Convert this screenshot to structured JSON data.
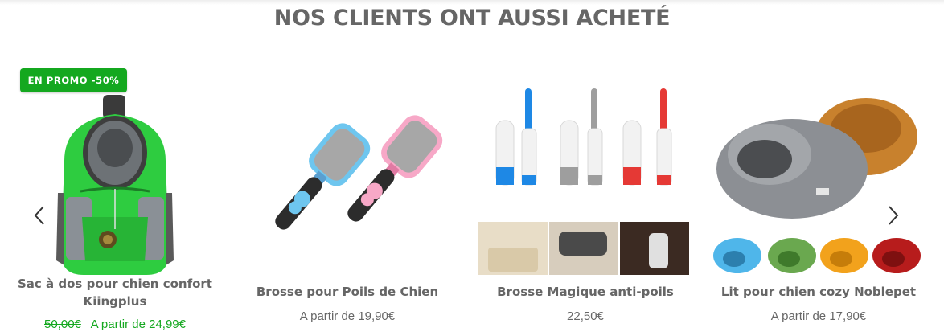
{
  "section": {
    "heading": "NOS CLIENTS ONT AUSSI ACHETÉ"
  },
  "carousel": {
    "prev_icon": "chevron-left-icon",
    "next_icon": "chevron-right-icon",
    "products": [
      {
        "title_line1": "Sac à dos pour chien confort",
        "title_line2": "Kiingplus",
        "badge": "EN PROMO -50%",
        "old_price": "50,00€",
        "price": "A partir de 24,99€"
      },
      {
        "title": "Brosse pour Poils de Chien",
        "price": "A partir de 19,90€"
      },
      {
        "title": "Brosse Magique anti-poils",
        "price": "22,50€"
      },
      {
        "title": "Lit pour chien cozy Noblepet",
        "price": "A partir de 17,90€"
      }
    ]
  },
  "colors": {
    "promo_green": "#14a81f",
    "text_gray": "#666666"
  }
}
